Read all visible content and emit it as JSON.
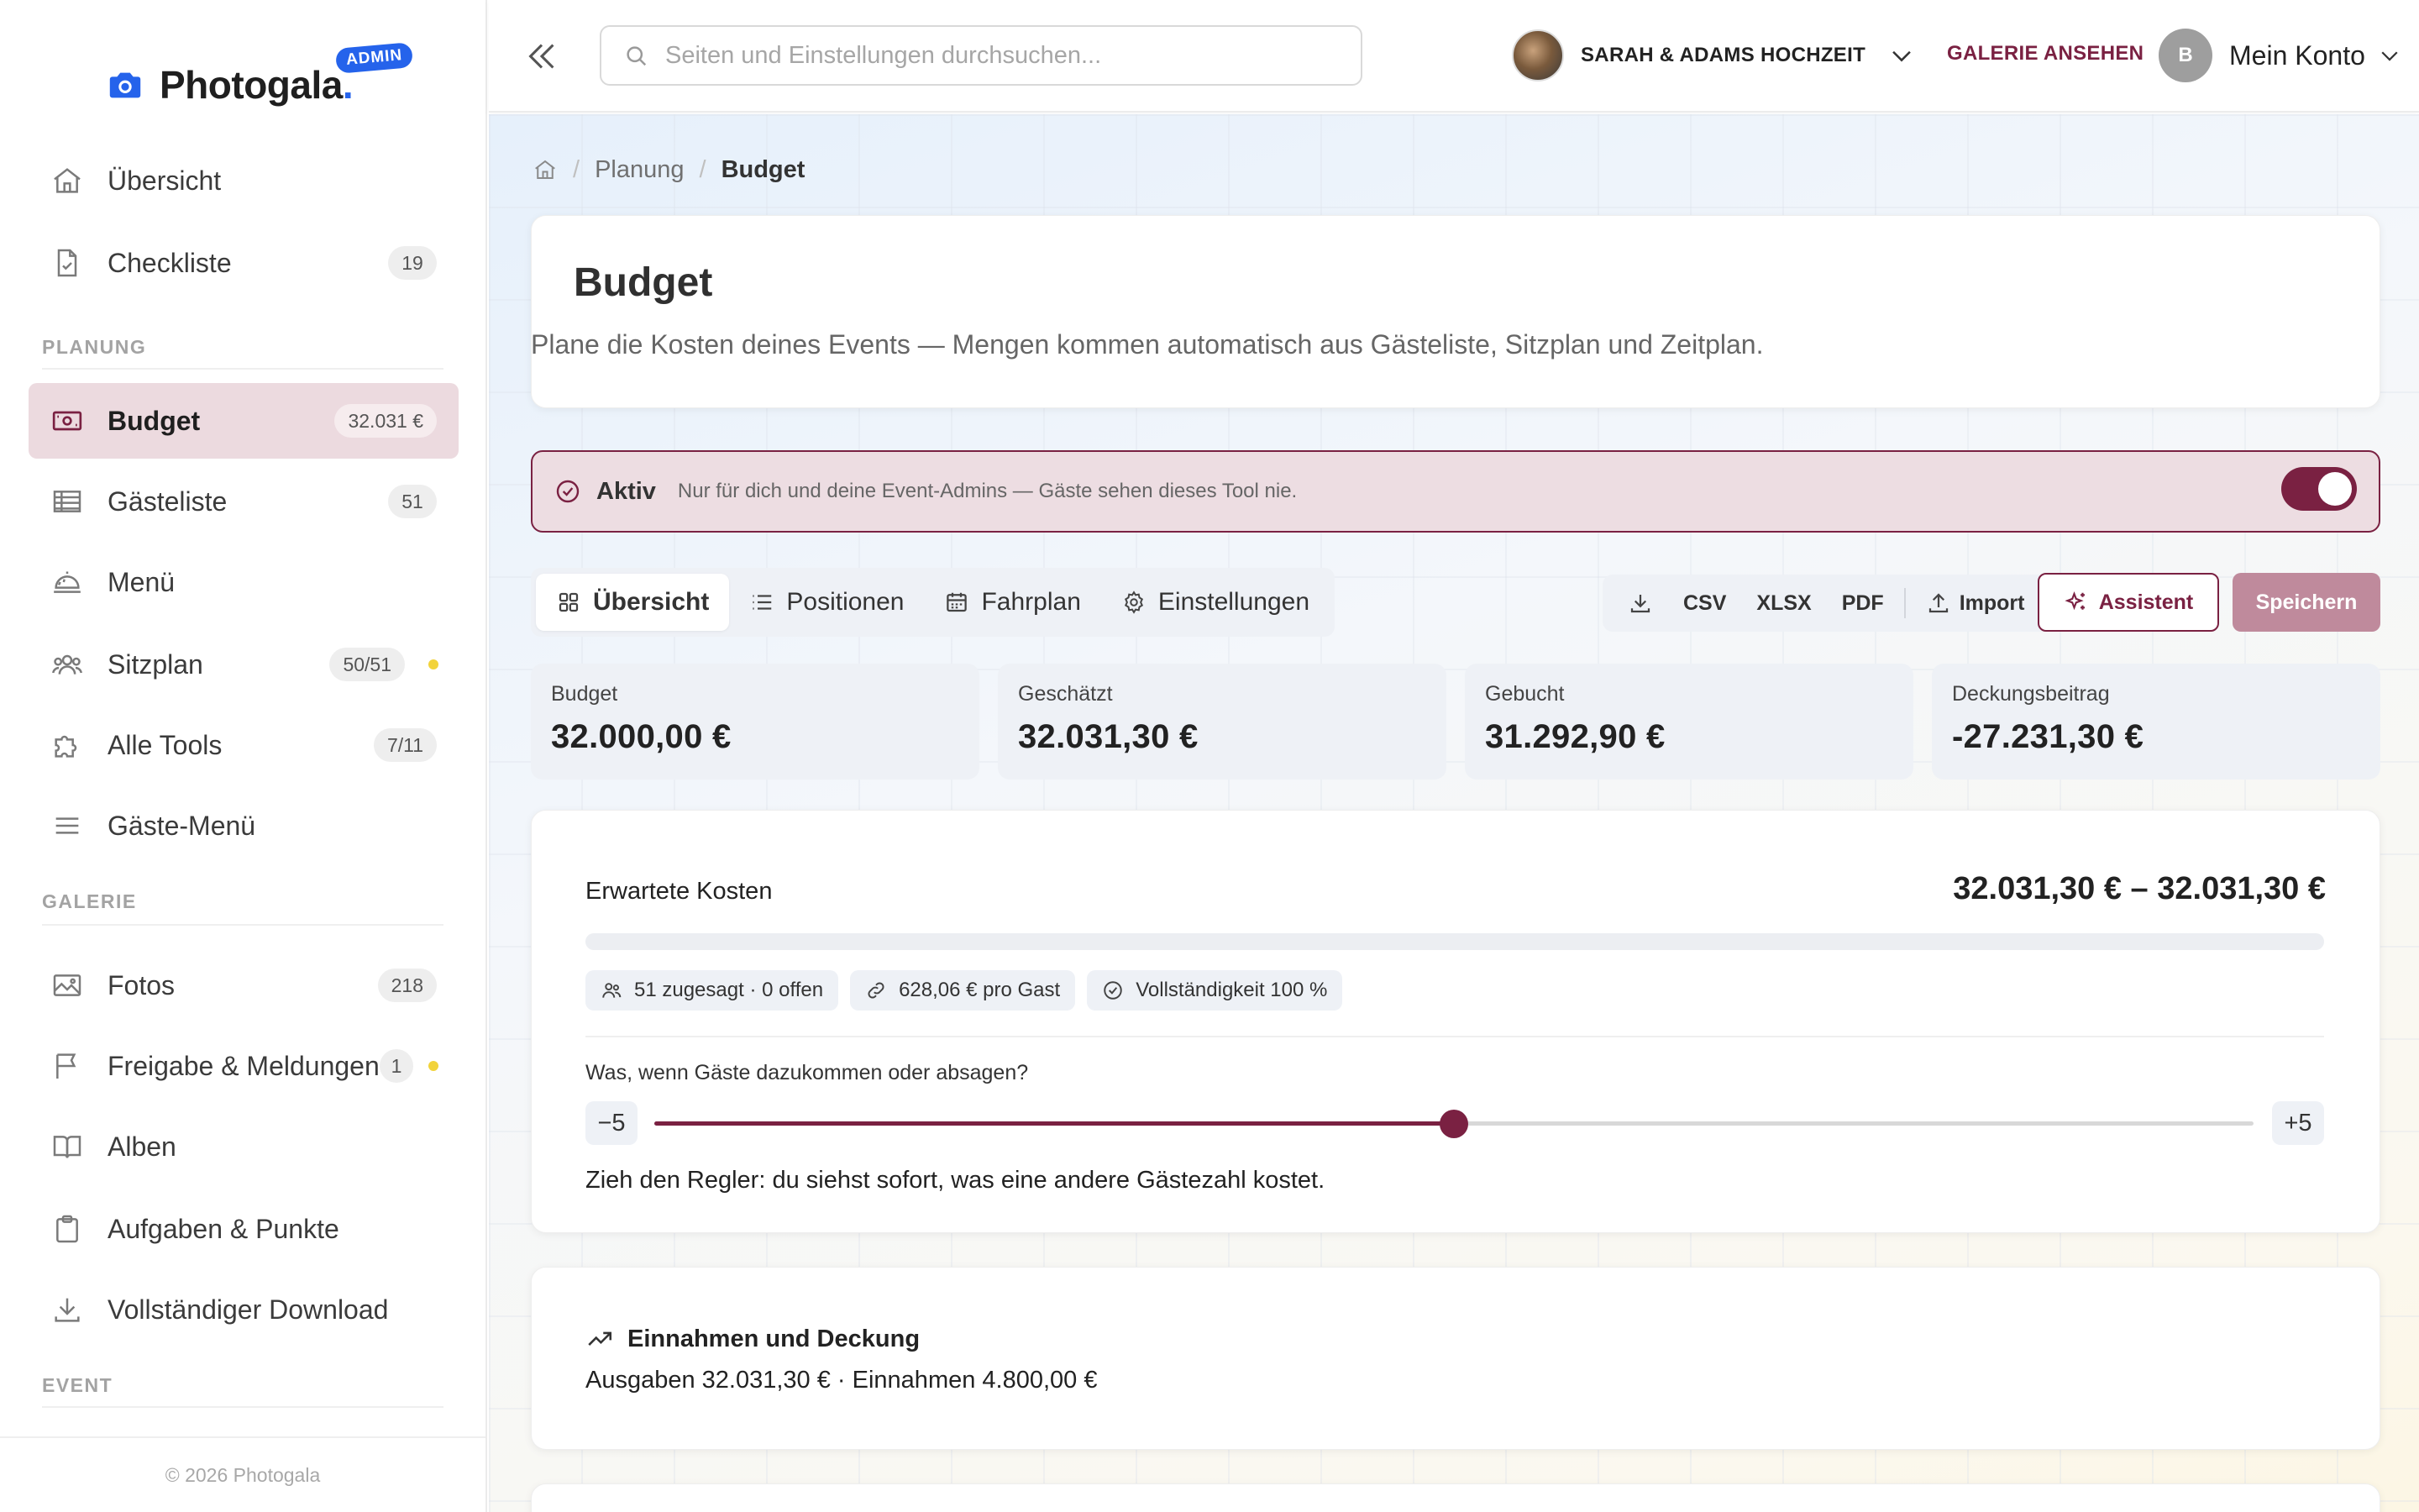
{
  "brand": {
    "name": "Photogala",
    "dot": ".",
    "badge": "ADMIN"
  },
  "sidebar": {
    "items_top": [
      {
        "label": "Übersicht",
        "icon": "home-icon"
      },
      {
        "label": "Checkliste",
        "icon": "checklist-icon",
        "badge": "19"
      }
    ],
    "section_planung": "PLANUNG",
    "items_planung": [
      {
        "label": "Budget",
        "icon": "budget-icon",
        "badge": "32.031 €",
        "active": true
      },
      {
        "label": "Gästeliste",
        "icon": "table-icon",
        "badge": "51"
      },
      {
        "label": "Menü",
        "icon": "cloche-icon"
      },
      {
        "label": "Sitzplan",
        "icon": "people-icon",
        "badge": "50/51",
        "dot": true
      },
      {
        "label": "Alle Tools",
        "icon": "puzzle-icon",
        "badge": "7/11"
      },
      {
        "label": "Gäste-Menü",
        "icon": "menu-lines-icon"
      }
    ],
    "section_galerie": "GALERIE",
    "items_galerie": [
      {
        "label": "Fotos",
        "icon": "image-icon",
        "badge": "218"
      },
      {
        "label": "Freigabe & Meldungen",
        "icon": "flag-icon",
        "badge": "1",
        "dot": true
      },
      {
        "label": "Alben",
        "icon": "book-icon"
      },
      {
        "label": "Aufgaben & Punkte",
        "icon": "clipboard-icon"
      },
      {
        "label": "Vollständiger Download",
        "icon": "download-icon"
      }
    ],
    "section_event": "EVENT",
    "footer": "© 2026 Photogala"
  },
  "topbar": {
    "search_placeholder": "Seiten und Einstellungen durchsuchen...",
    "event_name": "SARAH & ADAMS HOCHZEIT",
    "gallery_link": "GALERIE ANSEHEN",
    "account_initial": "B",
    "account_label": "Mein Konto"
  },
  "breadcrumb": {
    "parent": "Planung",
    "current": "Budget"
  },
  "header": {
    "title": "Budget",
    "subtitle": "Plane die Kosten deines Events — Mengen kommen automatisch aus Gästeliste, Sitzplan und Zeitplan."
  },
  "active_banner": {
    "label": "Aktiv",
    "description": "Nur für dich und deine Event-Admins — Gäste sehen dieses Tool nie.",
    "enabled": true
  },
  "tabs": [
    {
      "label": "Übersicht",
      "icon": "grid-icon",
      "active": true
    },
    {
      "label": "Positionen",
      "icon": "list-icon"
    },
    {
      "label": "Fahrplan",
      "icon": "calendar-icon"
    },
    {
      "label": "Einstellungen",
      "icon": "gear-icon"
    }
  ],
  "actions": {
    "csv": "CSV",
    "xlsx": "XLSX",
    "pdf": "PDF",
    "import": "Import",
    "assistant": "Assistent",
    "save": "Speichern"
  },
  "stats": [
    {
      "label": "Budget",
      "value": "32.000,00 €"
    },
    {
      "label": "Geschätzt",
      "value": "32.031,30 €"
    },
    {
      "label": "Gebucht",
      "value": "31.292,90 €"
    },
    {
      "label": "Deckungsbeitrag",
      "value": "-27.231,30 €"
    }
  ],
  "costs": {
    "title": "Erwartete Kosten",
    "range": "32.031,30 € – 32.031,30 €",
    "chips": [
      {
        "label": "51 zugesagt · 0 offen",
        "icon": "people-icon"
      },
      {
        "label": "628,06 € pro Gast",
        "icon": "link-icon"
      },
      {
        "label": "Vollständigkeit 100 %",
        "icon": "check-circle-icon"
      }
    ],
    "whatif_question": "Was, wenn Gäste dazukommen oder absagen?",
    "slider_min_label": "−5",
    "slider_max_label": "+5",
    "slider_min": -5,
    "slider_max": 5,
    "slider_value": 0,
    "hint": "Zieh den Regler: du siehst sofort, was eine andere Gästezahl kostet."
  },
  "income": {
    "title": "Einnahmen und Deckung",
    "summary": "Ausgaben 32.031,30 € · Einnahmen 4.800,00 €"
  },
  "colors": {
    "accent": "#7a2142",
    "accent_light": "#eddde2",
    "brand_blue": "#2563eb",
    "save_disabled": "#bf8a9c"
  }
}
